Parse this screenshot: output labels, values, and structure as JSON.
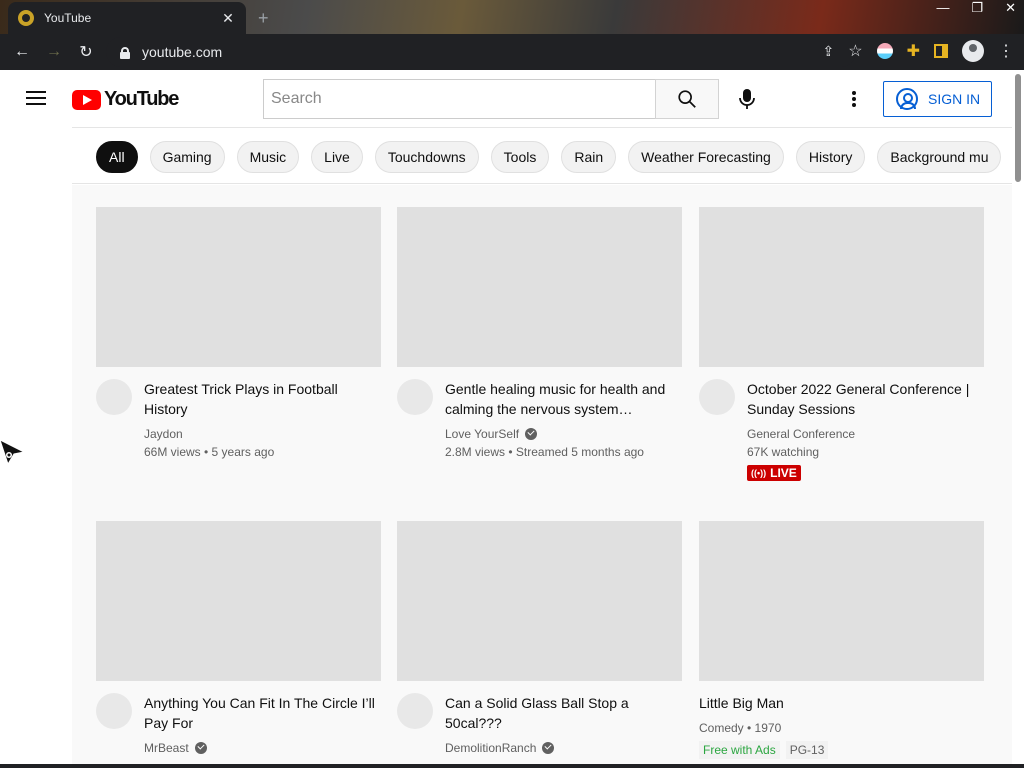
{
  "browser": {
    "tab_title": "YouTube",
    "tab_close": "✕",
    "new_tab": "+",
    "address": "youtube.com"
  },
  "header": {
    "logo_text": "YouTube",
    "search_placeholder": "Search",
    "sign_in": "SIGN IN"
  },
  "chips": [
    "All",
    "Gaming",
    "Music",
    "Live",
    "Touchdowns",
    "Tools",
    "Rain",
    "Weather Forecasting",
    "History",
    "Background mu"
  ],
  "videos": [
    {
      "title": "Greatest Trick Plays in Football History",
      "channel": "Jaydon",
      "verified": false,
      "stats": "66M views • 5 years ago"
    },
    {
      "title": "Gentle healing music for health and calming the nervous system…",
      "channel": "Love YourSelf",
      "verified": true,
      "stats": "2.8M views • Streamed 5 months ago"
    },
    {
      "title": "October 2022 General Conference | Sunday Sessions",
      "channel": "General Conference",
      "verified": false,
      "stats": "67K watching",
      "live": "LIVE"
    },
    {
      "title": "Anything You Can Fit In The Circle I’ll Pay For",
      "channel": "MrBeast",
      "verified": true,
      "stats": ""
    },
    {
      "title": "Can a Solid Glass Ball Stop a 50cal???",
      "channel": "DemolitionRanch",
      "verified": true,
      "stats": ""
    },
    {
      "title": "Little Big Man",
      "channel": "Comedy • 1970",
      "verified": false,
      "stats": "",
      "badges": [
        "Free with Ads",
        "PG-13"
      ]
    }
  ]
}
